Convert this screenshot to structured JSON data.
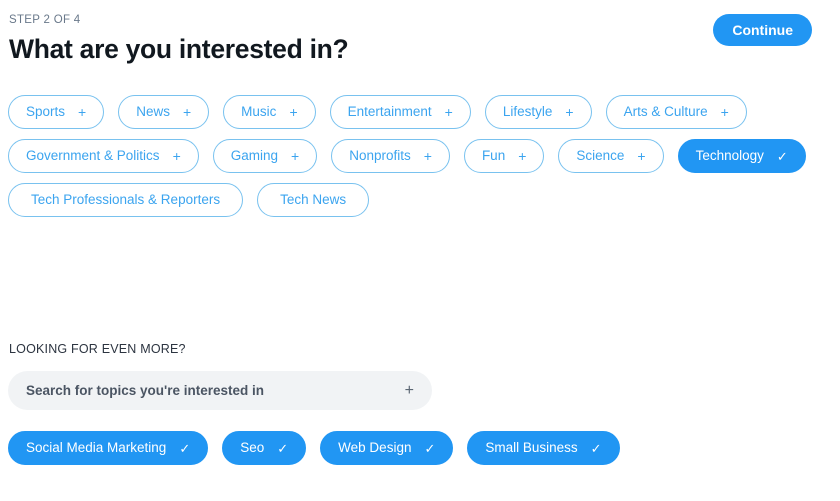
{
  "header": {
    "step_label": "STEP 2 OF 4",
    "title": "What are you interested in?",
    "continue_label": "Continue"
  },
  "colors": {
    "accent": "#2196f3",
    "chip_border": "#79c2ef",
    "chip_text": "#3ba4ef",
    "search_background": "#f1f3f5",
    "step_text": "#69788a"
  },
  "icons": {
    "add": "+",
    "check": "✓"
  },
  "topic_rows": [
    [
      {
        "label": "Sports",
        "selected": false,
        "mark": "+"
      },
      {
        "label": "News",
        "selected": false,
        "mark": "+"
      },
      {
        "label": "Music",
        "selected": false,
        "mark": "+"
      },
      {
        "label": "Entertainment",
        "selected": false,
        "mark": "+"
      },
      {
        "label": "Lifestyle",
        "selected": false,
        "mark": "+"
      },
      {
        "label": "Arts & Culture",
        "selected": false,
        "mark": "+"
      }
    ],
    [
      {
        "label": "Government & Politics",
        "selected": false,
        "mark": "+"
      },
      {
        "label": "Gaming",
        "selected": false,
        "mark": "+"
      },
      {
        "label": "Nonprofits",
        "selected": false,
        "mark": "+"
      },
      {
        "label": "Fun",
        "selected": false,
        "mark": "+"
      },
      {
        "label": "Science",
        "selected": false,
        "mark": "+"
      },
      {
        "label": "Technology",
        "selected": true,
        "mark": "✓"
      }
    ],
    [
      {
        "label": "Tech Professionals & Reporters",
        "selected": false,
        "mark": ""
      },
      {
        "label": "Tech News",
        "selected": false,
        "mark": ""
      }
    ]
  ],
  "more": {
    "label": "LOOKING FOR EVEN MORE?",
    "search_value": "",
    "search_placeholder": "Search for topics you're interested in",
    "add_icon": "+",
    "selected_topics": [
      {
        "label": "Social Media Marketing",
        "selected": true,
        "mark": "✓"
      },
      {
        "label": "Seo",
        "selected": true,
        "mark": "✓"
      },
      {
        "label": "Web Design",
        "selected": true,
        "mark": "✓"
      },
      {
        "label": "Small Business",
        "selected": true,
        "mark": "✓"
      }
    ]
  }
}
